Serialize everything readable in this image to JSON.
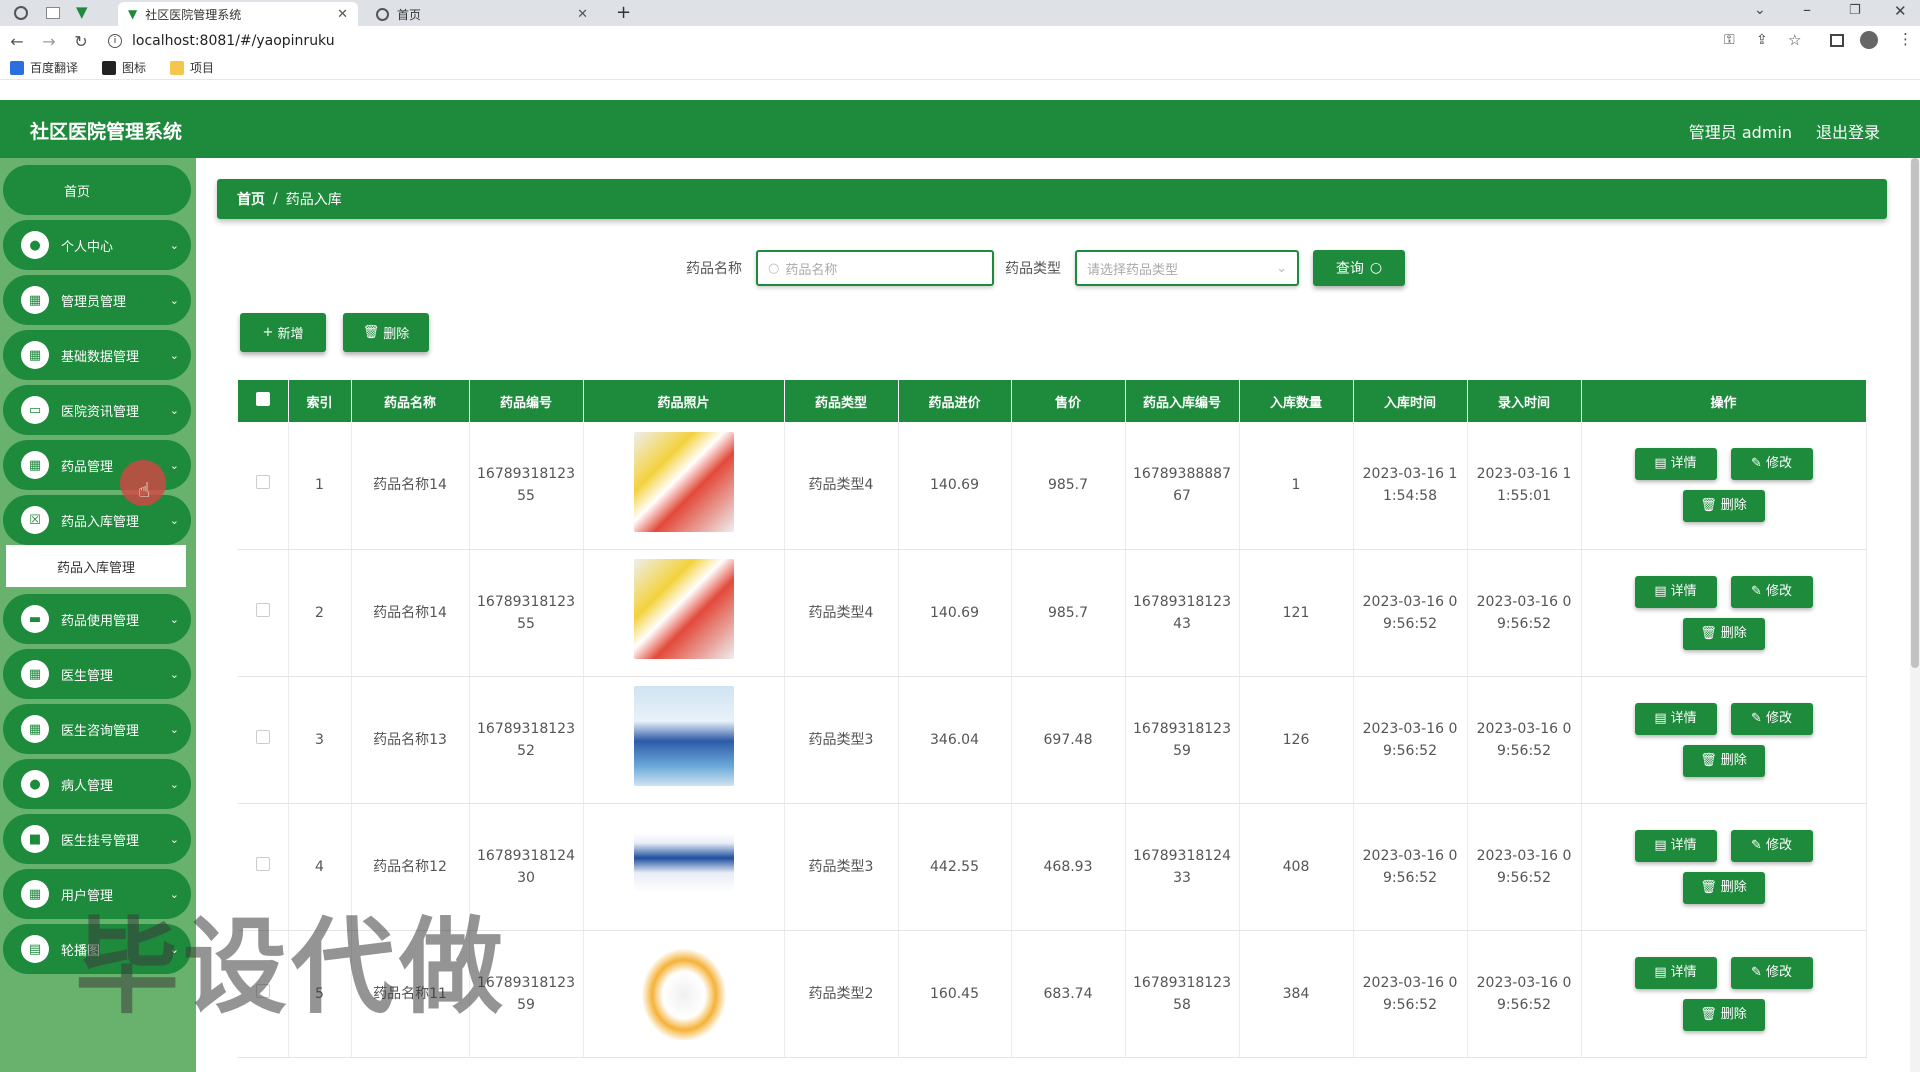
{
  "browser": {
    "tabs": [
      {
        "title": "社区医院管理系统"
      },
      {
        "title": "首页"
      }
    ],
    "url": "localhost:8081/#/yaopinruku",
    "bookmarks": [
      "百度翻译",
      "图标",
      "项目"
    ]
  },
  "app": {
    "title": "社区医院管理系统",
    "user": "管理员 admin",
    "logout": "退出登录",
    "accent": "#1e8a3c"
  },
  "sidebar": {
    "items": [
      {
        "label": "首页"
      },
      {
        "label": "个人中心"
      },
      {
        "label": "管理员管理"
      },
      {
        "label": "基础数据管理"
      },
      {
        "label": "医院资讯管理"
      },
      {
        "label": "药品管理"
      },
      {
        "label": "药品入库管理"
      },
      {
        "label": "药品使用管理"
      },
      {
        "label": "医生管理"
      },
      {
        "label": "医生咨询管理"
      },
      {
        "label": "病人管理"
      },
      {
        "label": "医生挂号管理"
      },
      {
        "label": "用户管理"
      },
      {
        "label": "轮播图"
      }
    ],
    "subitem": "药品入库管理"
  },
  "breadcrumb": {
    "home": "首页",
    "sep": "/",
    "current": "药品入库"
  },
  "search": {
    "name_label": "药品名称",
    "name_placeholder": "药品名称",
    "type_label": "药品类型",
    "type_placeholder": "请选择药品类型",
    "query_button": "查询"
  },
  "actions": {
    "add": "新增",
    "delete": "删除"
  },
  "table": {
    "headers": [
      "索引",
      "药品名称",
      "药品编号",
      "药品照片",
      "药品类型",
      "药品进价",
      "售价",
      "药品入库编号",
      "入库数量",
      "入库时间",
      "录入时间",
      "操作"
    ],
    "rows": [
      {
        "idx": "1",
        "name": "药品名称14",
        "code": "1678931812355",
        "type": "药品类型4",
        "cost": "140.69",
        "price": "985.7",
        "inbound_no": "1678938888767",
        "qty": "1",
        "in_time": "2023-03-16 11:54:58",
        "entry_time": "2023-03-16 11:55:01"
      },
      {
        "idx": "2",
        "name": "药品名称14",
        "code": "1678931812355",
        "type": "药品类型4",
        "cost": "140.69",
        "price": "985.7",
        "inbound_no": "1678931812343",
        "qty": "121",
        "in_time": "2023-03-16 09:56:52",
        "entry_time": "2023-03-16 09:56:52"
      },
      {
        "idx": "3",
        "name": "药品名称13",
        "code": "1678931812352",
        "type": "药品类型3",
        "cost": "346.04",
        "price": "697.48",
        "inbound_no": "1678931812359",
        "qty": "126",
        "in_time": "2023-03-16 09:56:52",
        "entry_time": "2023-03-16 09:56:52"
      },
      {
        "idx": "4",
        "name": "药品名称12",
        "code": "1678931812430",
        "type": "药品类型3",
        "cost": "442.55",
        "price": "468.93",
        "inbound_no": "1678931812433",
        "qty": "408",
        "in_time": "2023-03-16 09:56:52",
        "entry_time": "2023-03-16 09:56:52"
      },
      {
        "idx": "5",
        "name": "药品名称11",
        "code": "1678931812359",
        "type": "药品类型2",
        "cost": "160.45",
        "price": "683.74",
        "inbound_no": "1678931812358",
        "qty": "384",
        "in_time": "2023-03-16 09:56:52",
        "entry_time": "2023-03-16 09:56:52"
      }
    ],
    "row_actions": {
      "detail": "详情",
      "edit": "修改",
      "delete": "删除"
    }
  },
  "overlay_text": "毕设代做"
}
